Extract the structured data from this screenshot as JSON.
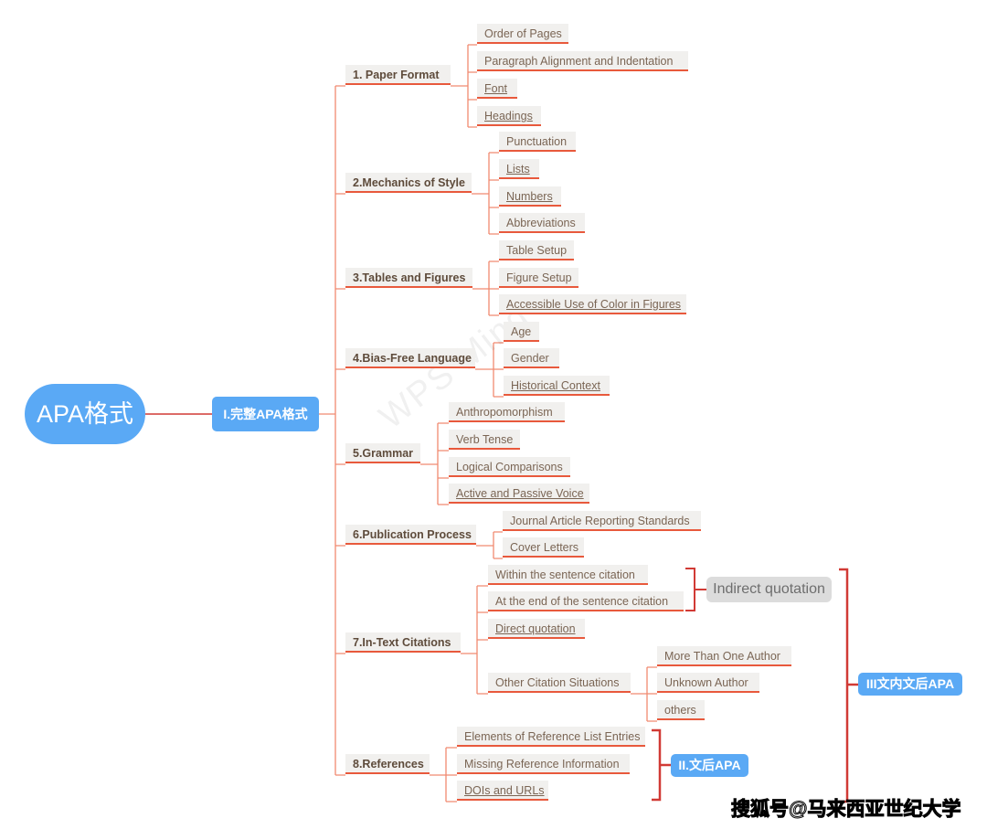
{
  "root": {
    "label": "APA格式"
  },
  "main_topic": {
    "label": "I.完整APA格式"
  },
  "sections": [
    {
      "label": "1. Paper Format",
      "children": [
        {
          "label": "Order of Pages",
          "linked": false
        },
        {
          "label": "Paragraph Alignment and Indentation",
          "linked": false
        },
        {
          "label": "Font",
          "linked": true
        },
        {
          "label": "Headings",
          "linked": true
        }
      ]
    },
    {
      "label": "2.Mechanics of Style",
      "children": [
        {
          "label": "Punctuation",
          "linked": false
        },
        {
          "label": "Lists",
          "linked": true
        },
        {
          "label": "Numbers",
          "linked": true
        },
        {
          "label": "Abbreviations",
          "linked": false
        }
      ]
    },
    {
      "label": "3.Tables and Figures",
      "children": [
        {
          "label": "Table Setup",
          "linked": false
        },
        {
          "label": "Figure Setup",
          "linked": false
        },
        {
          "label": "Accessible Use of Color in Figures",
          "linked": true
        }
      ]
    },
    {
      "label": "4.Bias-Free Language",
      "children": [
        {
          "label": "Age",
          "linked": false
        },
        {
          "label": "Gender",
          "linked": false
        },
        {
          "label": "Historical Context",
          "linked": true
        }
      ]
    },
    {
      "label": "5.Grammar",
      "children": [
        {
          "label": "Anthropomorphism",
          "linked": false
        },
        {
          "label": "Verb Tense",
          "linked": false
        },
        {
          "label": "Logical Comparisons",
          "linked": false
        },
        {
          "label": "Active and Passive Voice",
          "linked": true
        }
      ]
    },
    {
      "label": "6.Publication Process",
      "children": [
        {
          "label": "Journal Article Reporting Standards",
          "linked": false
        },
        {
          "label": "Cover Letters",
          "linked": false
        }
      ]
    },
    {
      "label": "7.In-Text Citations",
      "children": [
        {
          "label": "Within the sentence citation",
          "linked": false
        },
        {
          "label": "At the end of the sentence citation",
          "linked": false
        },
        {
          "label": "Direct quotation",
          "linked": true
        },
        {
          "label": "Other Citation Situations",
          "linked": false,
          "children": [
            {
              "label": "More Than One Author",
              "linked": false
            },
            {
              "label": "Unknown Author",
              "linked": false
            },
            {
              "label": "others",
              "linked": false
            }
          ]
        }
      ]
    },
    {
      "label": "8.References",
      "children": [
        {
          "label": "Elements of Reference List Entries",
          "linked": false
        },
        {
          "label": "Missing Reference Information",
          "linked": false
        },
        {
          "label": "DOIs and URLs",
          "linked": true
        }
      ]
    }
  ],
  "summaries": {
    "indirect": "Indirect quotation",
    "references": "II.文后APA",
    "in_text_and_refs": "III文内文后APA"
  },
  "watermark": "WPS Mind",
  "credit": "搜狐号@马来西亚世纪大学",
  "colors": {
    "topic": "#5aa9f5",
    "branch_line": "#f08a70",
    "underline": "#e8593c",
    "bracket": "#d13a35"
  }
}
